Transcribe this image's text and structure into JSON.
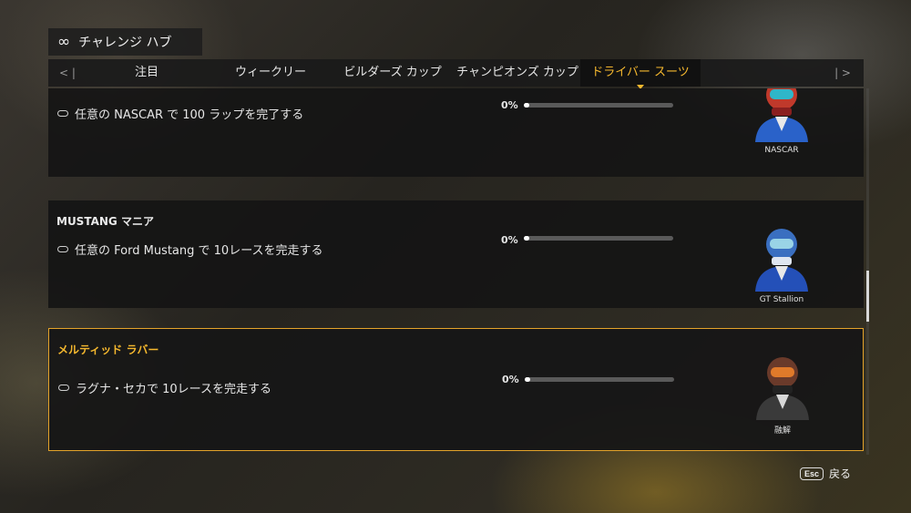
{
  "hub": {
    "icon": "infinity-icon",
    "icon_glyph": "∞",
    "title": "チャレンジ ハブ"
  },
  "tabs": {
    "prev_glyph": "< |",
    "next_glyph": "| >",
    "items": [
      {
        "label": "注目",
        "active": false
      },
      {
        "label": "ウィークリー",
        "active": false
      },
      {
        "label": "ビルダーズ カップ",
        "active": false
      },
      {
        "label": "チャンピオンズ カップ",
        "active": false
      },
      {
        "label": "ドライバー スーツ",
        "active": true
      }
    ]
  },
  "challenges": [
    {
      "title": "",
      "task": "任意の NASCAR で 100 ラップを完了する",
      "progress_label": "0%",
      "progress": 0,
      "reward_label": "NASCAR",
      "reward_icon": "driver-helmet-icon",
      "colors": {
        "helmet": "#c0392b",
        "suit": "#2a62c9"
      },
      "selected": false
    },
    {
      "title": "MUSTANG マニア",
      "task": "任意の Ford Mustang で 10レースを完走する",
      "progress_label": "0%",
      "progress": 0,
      "reward_label": "GT Stallion",
      "reward_icon": "driver-helmet-icon",
      "colors": {
        "helmet": "#3a6fc0",
        "suit": "#2450b8"
      },
      "selected": false
    },
    {
      "title": "メルティッド ラバー",
      "task": "ラグナ・セカで 10レースを完走する",
      "progress_label": "0%",
      "progress": 0,
      "reward_label": "融解",
      "reward_icon": "driver-helmet-icon",
      "colors": {
        "helmet": "#6a3a2a",
        "suit": "#3a3a3a"
      },
      "selected": true
    }
  ],
  "footer": {
    "key": "Esc",
    "back_label": "戻る"
  },
  "colors": {
    "accent": "#f5b82e",
    "selected_border": "#e4a32a"
  }
}
